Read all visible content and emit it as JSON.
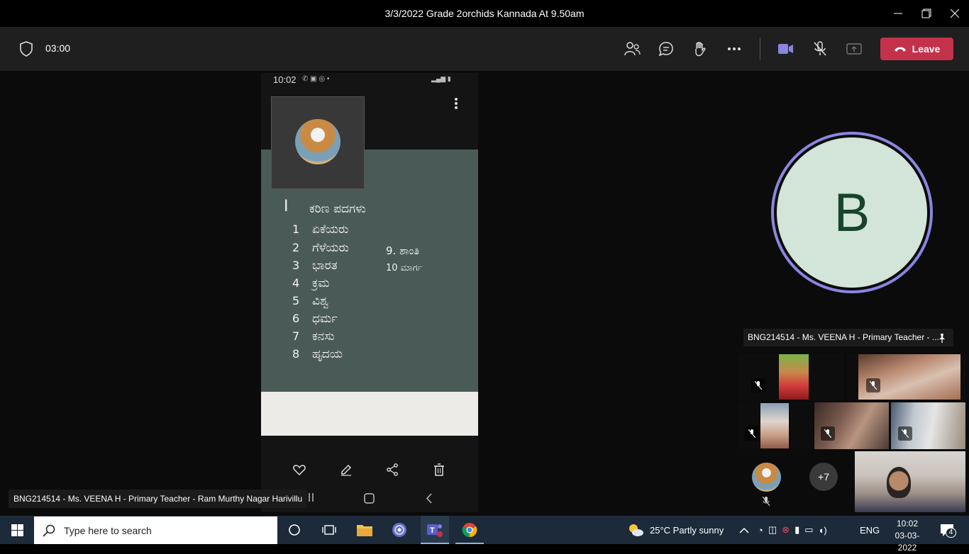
{
  "window": {
    "title": "3/3/2022 Grade 2orchids Kannada At 9.50am"
  },
  "toolbar": {
    "timer": "03:00",
    "leave_label": "Leave"
  },
  "phone": {
    "status_time": "10:02",
    "board_lines": [
      {
        "num": "I",
        "text": "ಕರಿಣ ಪದಗಳು"
      },
      {
        "num": "1",
        "text": "ಏಕೆಯರು"
      },
      {
        "num": "2",
        "text": "ಗೆಳೆಯರು"
      },
      {
        "num": "3",
        "text": "ಭಾರತ"
      },
      {
        "num": "4",
        "text": "ಕ್ರಮ"
      },
      {
        "num": "5",
        "text": "ವಿಶ್ವ"
      },
      {
        "num": "6",
        "text": "ಧರ್ಮ"
      },
      {
        "num": "7",
        "text": "ಕನಸು"
      },
      {
        "num": "8",
        "text": "ಹೃದಯ"
      }
    ],
    "board_side": [
      "9. ಶಾಂತಿ",
      "10 ಮಾರ್ಗ"
    ]
  },
  "presenter": {
    "name_tag": "BNG214514 - Ms. VEENA H - Primary Teacher - Ram Murthy Nagar Harivillu"
  },
  "participants": {
    "big_initial": "B",
    "pinned_label": "BNG214514 - Ms. VEENA H - Primary Teacher - ...",
    "more_count": "+7"
  },
  "taskbar": {
    "search_placeholder": "Type here to search",
    "weather": "25°C  Partly sunny",
    "lang": "ENG",
    "time": "10:02",
    "date": "03-03-2022",
    "notif_count": "4"
  }
}
